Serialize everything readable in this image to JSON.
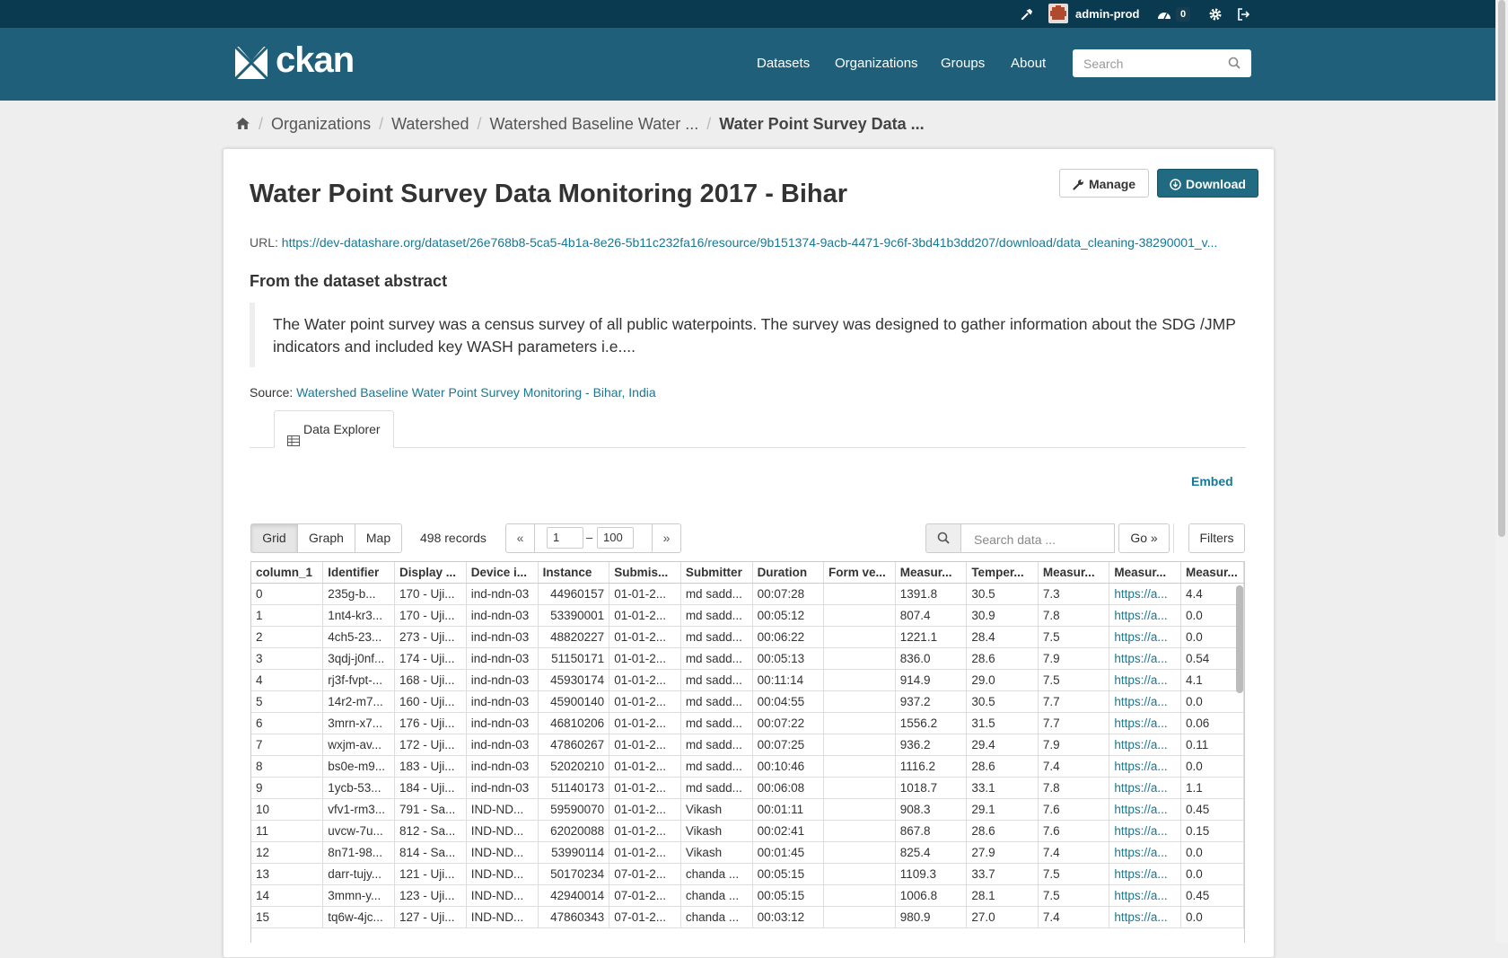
{
  "topbar": {
    "user": "admin-prod",
    "notifications": "0"
  },
  "header": {
    "logo_text": "ckan",
    "nav": [
      "Datasets",
      "Organizations",
      "Groups",
      "About"
    ],
    "search_placeholder": "Search"
  },
  "breadcrumb": [
    "Organizations",
    "Watershed",
    "Watershed Baseline Water ...",
    "Water Point Survey Data ..."
  ],
  "resource": {
    "title": "Water Point Survey Data Monitoring 2017 - Bihar",
    "manage_label": "Manage",
    "download_label": "Download",
    "url_label": "URL:",
    "url": "https://dev-datashare.org/dataset/26e768b8-5ca5-4b1a-8e26-5b11c232fa16/resource/9b151374-9acb-4471-9c6f-3bd41b3dd207/download/data_cleaning-38290001_v...",
    "abstract_heading": "From the dataset abstract",
    "abstract": "The Water point survey was a census survey of all public waterpoints. The survey was designed to gather information about the SDG /JMP indicators and included key WASH parameters i.e....",
    "source_label": "Source:",
    "source_link": "Watershed Baseline Water Point Survey Monitoring - Bihar, India"
  },
  "explorer": {
    "tab_label": "Data Explorer",
    "embed_label": "Embed",
    "views": [
      "Grid",
      "Graph",
      "Map"
    ],
    "active_view": "Grid",
    "records": "498 records",
    "prev": "«",
    "next": "»",
    "page_from": "1",
    "page_to": "100",
    "page_sep": "–",
    "search_placeholder": "Search data ...",
    "go_label": "Go »",
    "filters_label": "Filters"
  },
  "grid": {
    "columns": [
      "column_1",
      "Identifier",
      "Display ...",
      "Device i...",
      "Instance",
      "Submis...",
      "Submitter",
      "Duration",
      "Form ve...",
      "Measur...",
      "Temper...",
      "Measur...",
      "Measur...",
      "Measur..."
    ],
    "rows": [
      [
        "0",
        "235g-b...",
        "170 - Uji...",
        "ind-ndn-03",
        "44960157",
        "01-01-2...",
        "md sadd...",
        "00:07:28",
        "",
        "1391.8",
        "30.5",
        "7.3",
        "https://a...",
        "4.4"
      ],
      [
        "1",
        "1nt4-kr3...",
        "170 - Uji...",
        "ind-ndn-03",
        "53390001",
        "01-01-2...",
        "md sadd...",
        "00:05:12",
        "",
        "807.4",
        "30.9",
        "7.8",
        "https://a...",
        "0.0"
      ],
      [
        "2",
        "4ch5-23...",
        "273 - Uji...",
        "ind-ndn-03",
        "48820227",
        "01-01-2...",
        "md sadd...",
        "00:06:22",
        "",
        "1221.1",
        "28.4",
        "7.5",
        "https://a...",
        "0.0"
      ],
      [
        "3",
        "3qdj-j0nf...",
        "174 - Uji...",
        "ind-ndn-03",
        "51150171",
        "01-01-2...",
        "md sadd...",
        "00:05:13",
        "",
        "836.0",
        "28.6",
        "7.9",
        "https://a...",
        "0.54"
      ],
      [
        "4",
        "rj3f-fvpt-...",
        "168 - Uji...",
        "ind-ndn-03",
        "45930174",
        "01-01-2...",
        "md sadd...",
        "00:11:14",
        "",
        "914.9",
        "29.0",
        "7.5",
        "https://a...",
        "4.1"
      ],
      [
        "5",
        "14r2-m7...",
        "160 - Uji...",
        "ind-ndn-03",
        "45900140",
        "01-01-2...",
        "md sadd...",
        "00:04:55",
        "",
        "937.2",
        "30.5",
        "7.7",
        "https://a...",
        "0.0"
      ],
      [
        "6",
        "3mrn-x7...",
        "176 - Uji...",
        "ind-ndn-03",
        "46810206",
        "01-01-2...",
        "md sadd...",
        "00:07:22",
        "",
        "1556.2",
        "31.5",
        "7.7",
        "https://a...",
        "0.06"
      ],
      [
        "7",
        "wxjm-av...",
        "172 - Uji...",
        "ind-ndn-03",
        "47860267",
        "01-01-2...",
        "md sadd...",
        "00:07:25",
        "",
        "936.2",
        "29.4",
        "7.9",
        "https://a...",
        "0.11"
      ],
      [
        "8",
        "bs0e-m9...",
        "183 - Uji...",
        "ind-ndn-03",
        "52020210",
        "01-01-2...",
        "md sadd...",
        "00:10:46",
        "",
        "1116.2",
        "28.6",
        "7.4",
        "https://a...",
        "0.0"
      ],
      [
        "9",
        "1ycb-53...",
        "184 - Uji...",
        "ind-ndn-03",
        "51140173",
        "01-01-2...",
        "md sadd...",
        "00:06:08",
        "",
        "1018.7",
        "33.1",
        "7.8",
        "https://a...",
        "1.1"
      ],
      [
        "10",
        "vfv1-rm3...",
        "791 - Sa...",
        "IND-ND...",
        "59590070",
        "01-01-2...",
        "Vikash",
        "00:01:11",
        "",
        "908.3",
        "29.1",
        "7.6",
        "https://a...",
        "0.45"
      ],
      [
        "11",
        "uvcw-7u...",
        "812 - Sa...",
        "IND-ND...",
        "62020088",
        "01-01-2...",
        "Vikash",
        "00:02:41",
        "",
        "867.8",
        "28.6",
        "7.6",
        "https://a...",
        "0.15"
      ],
      [
        "12",
        "8n71-98...",
        "814 - Sa...",
        "IND-ND...",
        "53990114",
        "01-01-2...",
        "Vikash",
        "00:01:45",
        "",
        "825.4",
        "27.9",
        "7.4",
        "https://a...",
        "0.0"
      ],
      [
        "13",
        "darr-tujy...",
        "121 - Uji...",
        "IND-ND...",
        "50170234",
        "07-01-2...",
        "chanda ...",
        "00:05:15",
        "",
        "1109.3",
        "33.7",
        "7.5",
        "https://a...",
        "0.0"
      ],
      [
        "14",
        "3mmn-y...",
        "123 - Uji...",
        "IND-ND...",
        "42940014",
        "07-01-2...",
        "chanda ...",
        "00:05:15",
        "",
        "1006.8",
        "28.1",
        "7.5",
        "https://a...",
        "0.45"
      ],
      [
        "15",
        "tq6w-4jc...",
        "127 - Uji...",
        "IND-ND...",
        "47860343",
        "07-01-2...",
        "chanda ...",
        "00:03:12",
        "",
        "980.9",
        "27.0",
        "7.4",
        "https://a...",
        "0.0"
      ]
    ]
  }
}
